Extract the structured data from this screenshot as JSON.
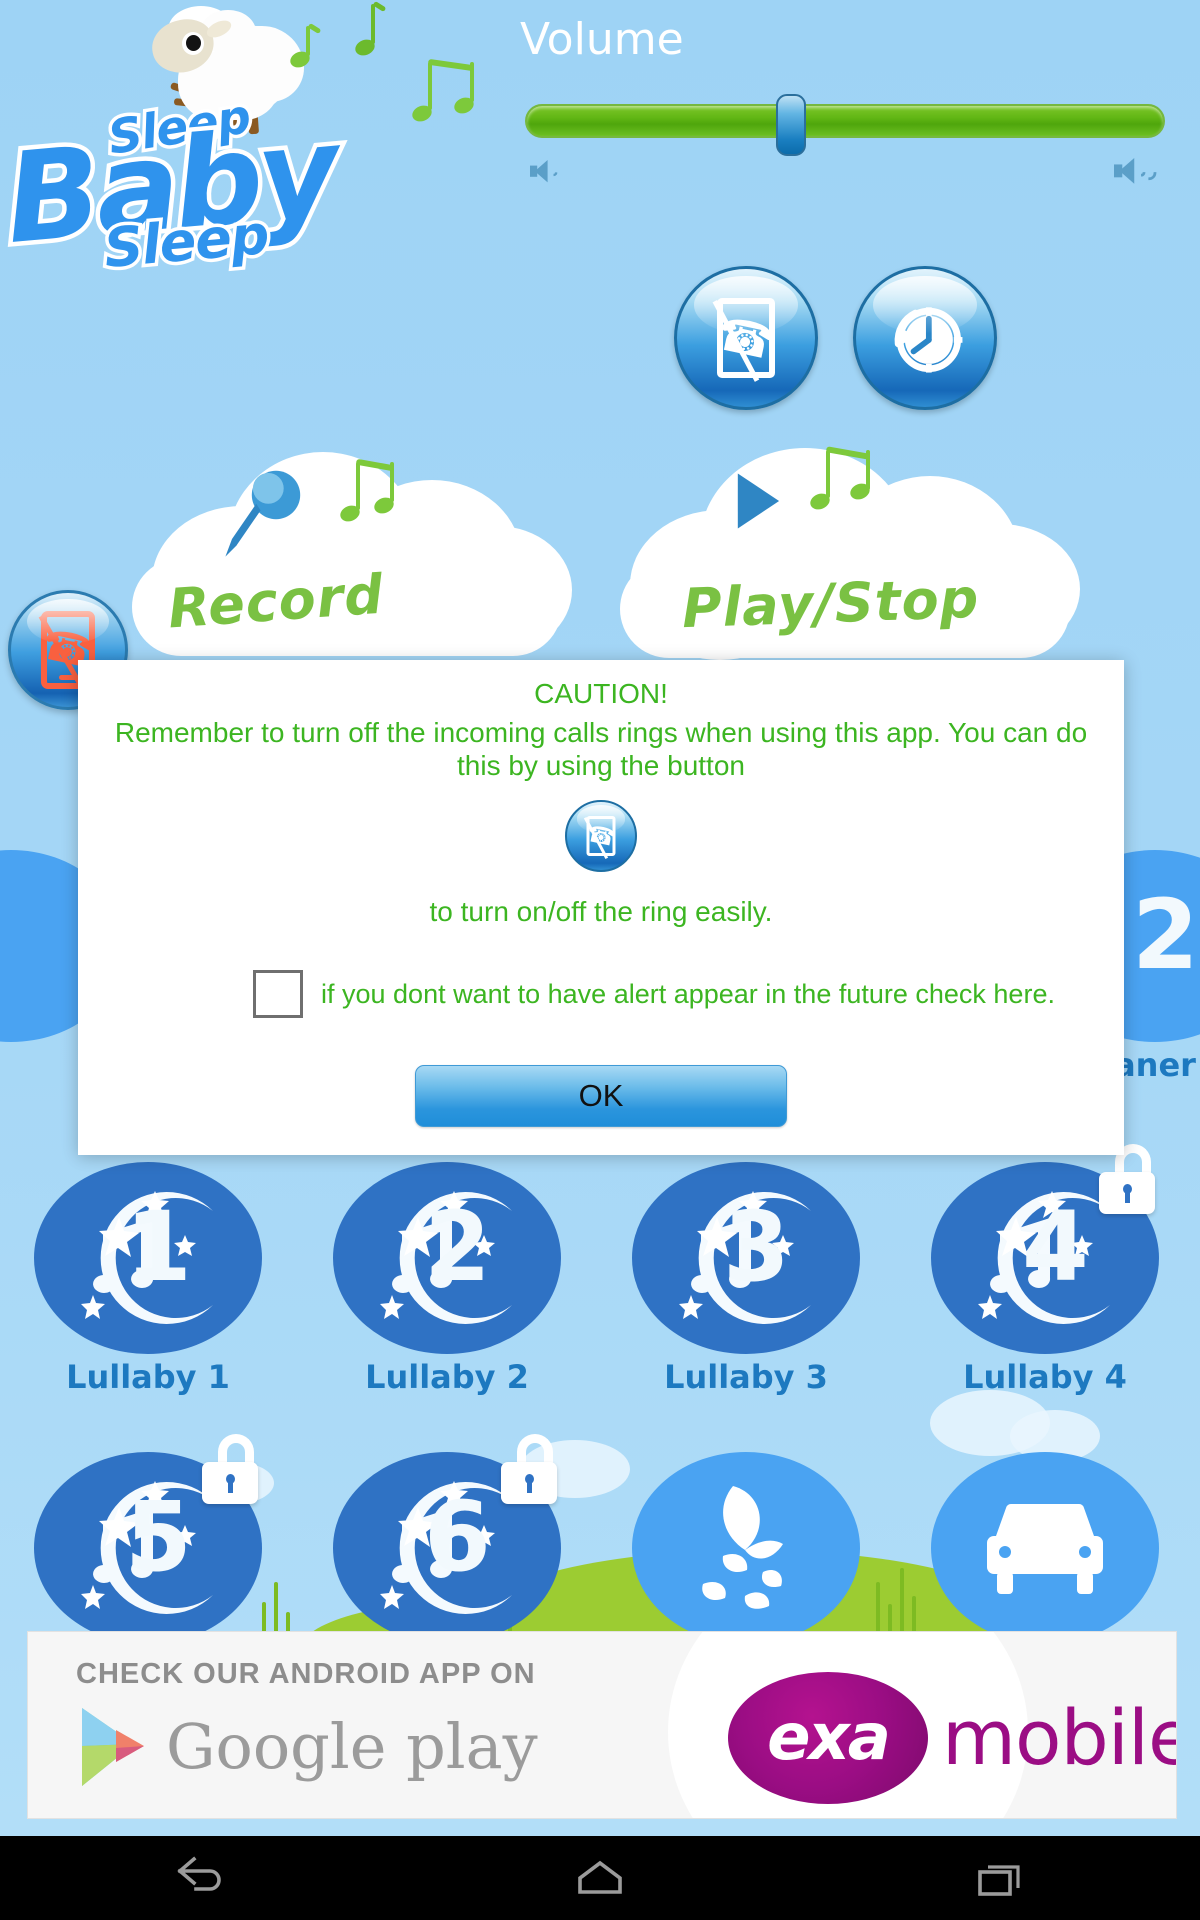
{
  "app": {
    "title": "Sleep Baby Sleep",
    "logo": {
      "word_top": "Sleep",
      "word_mid": "Baby",
      "word_bottom": "Sleep",
      "sheep_icon": "sheep-icon"
    },
    "background_color": "#9ed3f5"
  },
  "volume": {
    "label": "Volume",
    "value_percent": 41,
    "track_color": "#62b715",
    "thumb_color": "#1a7fc1",
    "low_icon": "speaker-low-icon",
    "high_icon": "speaker-high-icon"
  },
  "header_buttons": [
    {
      "name": "ring-toggle-button",
      "icon": "phone-mute-icon"
    },
    {
      "name": "timer-button",
      "icon": "clock-timer-icon"
    }
  ],
  "silence_button": {
    "name": "silence-ring-button",
    "icon": "phone-mute-red-icon"
  },
  "clouds": [
    {
      "label": "Record",
      "icon": "microphone-icon"
    },
    {
      "label": "Play/Stop",
      "icon": "play-triangle-icon"
    }
  ],
  "hidden_tiles": [
    {
      "label": "",
      "icon": "circle-blue"
    },
    {
      "number": "2",
      "label": "aner"
    }
  ],
  "lullabies": [
    {
      "number": "1",
      "label": "Lullaby 1",
      "locked": false,
      "color": "#2f72c4"
    },
    {
      "number": "2",
      "label": "Lullaby 2",
      "locked": false,
      "color": "#2f72c4"
    },
    {
      "number": "3",
      "label": "Lullaby 3",
      "locked": false,
      "color": "#2f72c4"
    },
    {
      "number": "4",
      "label": "Lullaby 4",
      "locked": true,
      "color": "#2f72c4"
    }
  ],
  "sounds_row": [
    {
      "number": "5",
      "label": "",
      "locked": true,
      "color": "#2f72c4",
      "icon": "moon-note-icon"
    },
    {
      "number": "6",
      "label": "",
      "locked": true,
      "color": "#2f72c4",
      "icon": "moon-note-icon"
    },
    {
      "number": "",
      "label": "",
      "locked": false,
      "color": "#4aa3f2",
      "icon": "nature-leaves-icon"
    },
    {
      "number": "",
      "label": "",
      "locked": false,
      "color": "#4aa3f2",
      "icon": "car-icon"
    }
  ],
  "dialog": {
    "title": "CAUTION!",
    "body": "Remember to turn off the incoming calls rings when using this app. You can do this by using the button",
    "inline_icon": "phone-mute-icon",
    "tail": "to turn on/off the ring easily.",
    "checkbox_checked": false,
    "checkbox_label": "if you dont want to have alert appear in the future check here.",
    "ok_label": "OK",
    "text_color": "#3cb521"
  },
  "ad": {
    "headline": "CHECK OUR ANDROID APP ON",
    "store": "Google play",
    "store_icon": "google-play-triangle-icon",
    "brand_mark": "exa",
    "brand_word": "mobile",
    "brand_color": "#9b0d84"
  },
  "navbar": {
    "buttons": [
      {
        "name": "nav-back-button",
        "icon": "back-arrow-icon"
      },
      {
        "name": "nav-home-button",
        "icon": "home-icon"
      },
      {
        "name": "nav-recents-button",
        "icon": "recents-icon"
      }
    ]
  }
}
